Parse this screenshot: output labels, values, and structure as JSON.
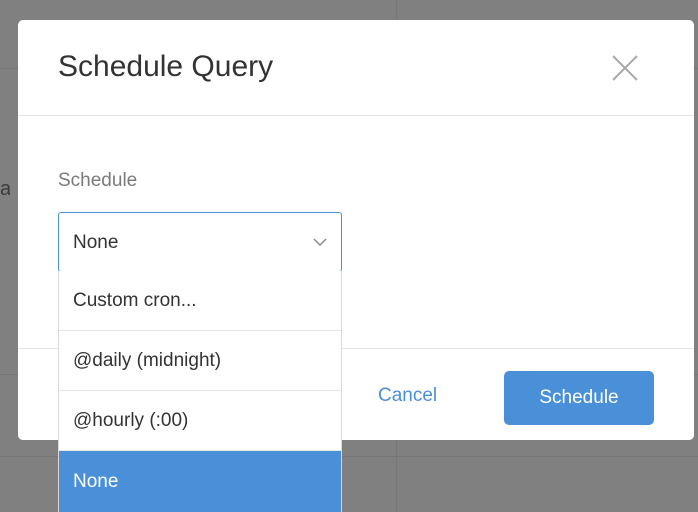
{
  "backdrop": {
    "peek_text": "a"
  },
  "modal": {
    "title": "Schedule Query",
    "field_label": "Schedule",
    "select": {
      "value": "None",
      "options": [
        "Custom cron...",
        "@daily (midnight)",
        "@hourly (:00)",
        "None"
      ],
      "selected_index": 3
    },
    "footer": {
      "cancel_label": "Cancel",
      "submit_label": "Schedule"
    }
  },
  "colors": {
    "accent": "#4a90d9",
    "backdrop": "#808080"
  },
  "icons": {
    "close": "close-icon",
    "chevron": "chevron-down-icon"
  }
}
